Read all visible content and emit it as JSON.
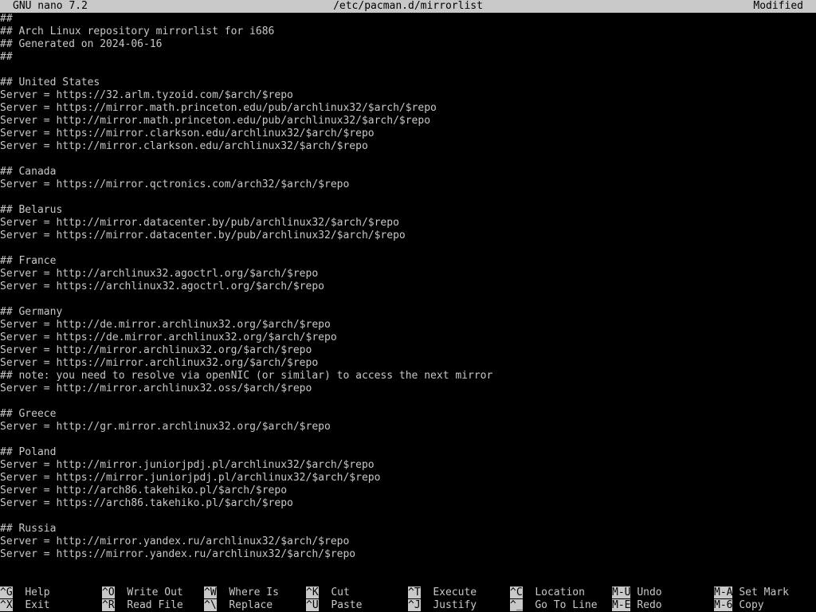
{
  "titlebar": {
    "app": "GNU nano 7.2",
    "file": "/etc/pacman.d/mirrorlist",
    "status": "Modified"
  },
  "buffer": {
    "lines": [
      "##",
      "## Arch Linux repository mirrorlist for i686",
      "## Generated on 2024-06-16",
      "##",
      "",
      "## United States",
      "Server = https://32.arlm.tyzoid.com/$arch/$repo",
      "Server = https://mirror.math.princeton.edu/pub/archlinux32/$arch/$repo",
      "Server = http://mirror.math.princeton.edu/pub/archlinux32/$arch/$repo",
      "Server = https://mirror.clarkson.edu/archlinux32/$arch/$repo",
      "Server = http://mirror.clarkson.edu/archlinux32/$arch/$repo",
      "",
      "## Canada",
      "Server = https://mirror.qctronics.com/arch32/$arch/$repo",
      "",
      "## Belarus",
      "Server = http://mirror.datacenter.by/pub/archlinux32/$arch/$repo",
      "Server = https://mirror.datacenter.by/pub/archlinux32/$arch/$repo",
      "",
      "## France",
      "Server = http://archlinux32.agoctrl.org/$arch/$repo",
      "Server = https://archlinux32.agoctrl.org/$arch/$repo",
      "",
      "## Germany",
      "Server = http://de.mirror.archlinux32.org/$arch/$repo",
      "Server = https://de.mirror.archlinux32.org/$arch/$repo",
      "Server = http://mirror.archlinux32.org/$arch/$repo",
      "Server = https://mirror.archlinux32.org/$arch/$repo",
      "## note: you need to resolve via openNIC (or similar) to access the next mirror",
      "Server = http://mirror.archlinux32.oss/$arch/$repo",
      "",
      "## Greece",
      "Server = http://gr.mirror.archlinux32.org/$arch/$repo",
      "",
      "## Poland",
      "Server = http://mirror.juniorjpdj.pl/archlinux32/$arch/$repo",
      "Server = https://mirror.juniorjpdj.pl/archlinux32/$arch/$repo",
      "Server = http://arch86.takehiko.pl/$arch/$repo",
      "Server = https://arch86.takehiko.pl/$arch/$repo",
      "",
      "## Russia",
      "Server = http://mirror.yandex.ru/archlinux32/$arch/$repo",
      "Server = https://mirror.yandex.ru/archlinux32/$arch/$repo"
    ]
  },
  "shortcuts": {
    "row1": [
      {
        "key": "^G",
        "label": "Help"
      },
      {
        "key": "^O",
        "label": "Write Out"
      },
      {
        "key": "^W",
        "label": "Where Is"
      },
      {
        "key": "^K",
        "label": "Cut"
      },
      {
        "key": "^T",
        "label": "Execute"
      },
      {
        "key": "^C",
        "label": "Location"
      },
      {
        "key": "M-U",
        "label": "Undo"
      },
      {
        "key": "M-A",
        "label": "Set Mark"
      }
    ],
    "row2": [
      {
        "key": "^X",
        "label": "Exit"
      },
      {
        "key": "^R",
        "label": "Read File"
      },
      {
        "key": "^\\",
        "label": "Replace"
      },
      {
        "key": "^U",
        "label": "Paste"
      },
      {
        "key": "^J",
        "label": "Justify"
      },
      {
        "key": "^_",
        "label": "Go To Line"
      },
      {
        "key": "M-E",
        "label": "Redo"
      },
      {
        "key": "M-6",
        "label": "Copy"
      }
    ]
  },
  "colors": {
    "background": "#000000",
    "text": "#c8c8c8",
    "inverse_bg": "#c8c8c8",
    "inverse_fg": "#000000"
  }
}
